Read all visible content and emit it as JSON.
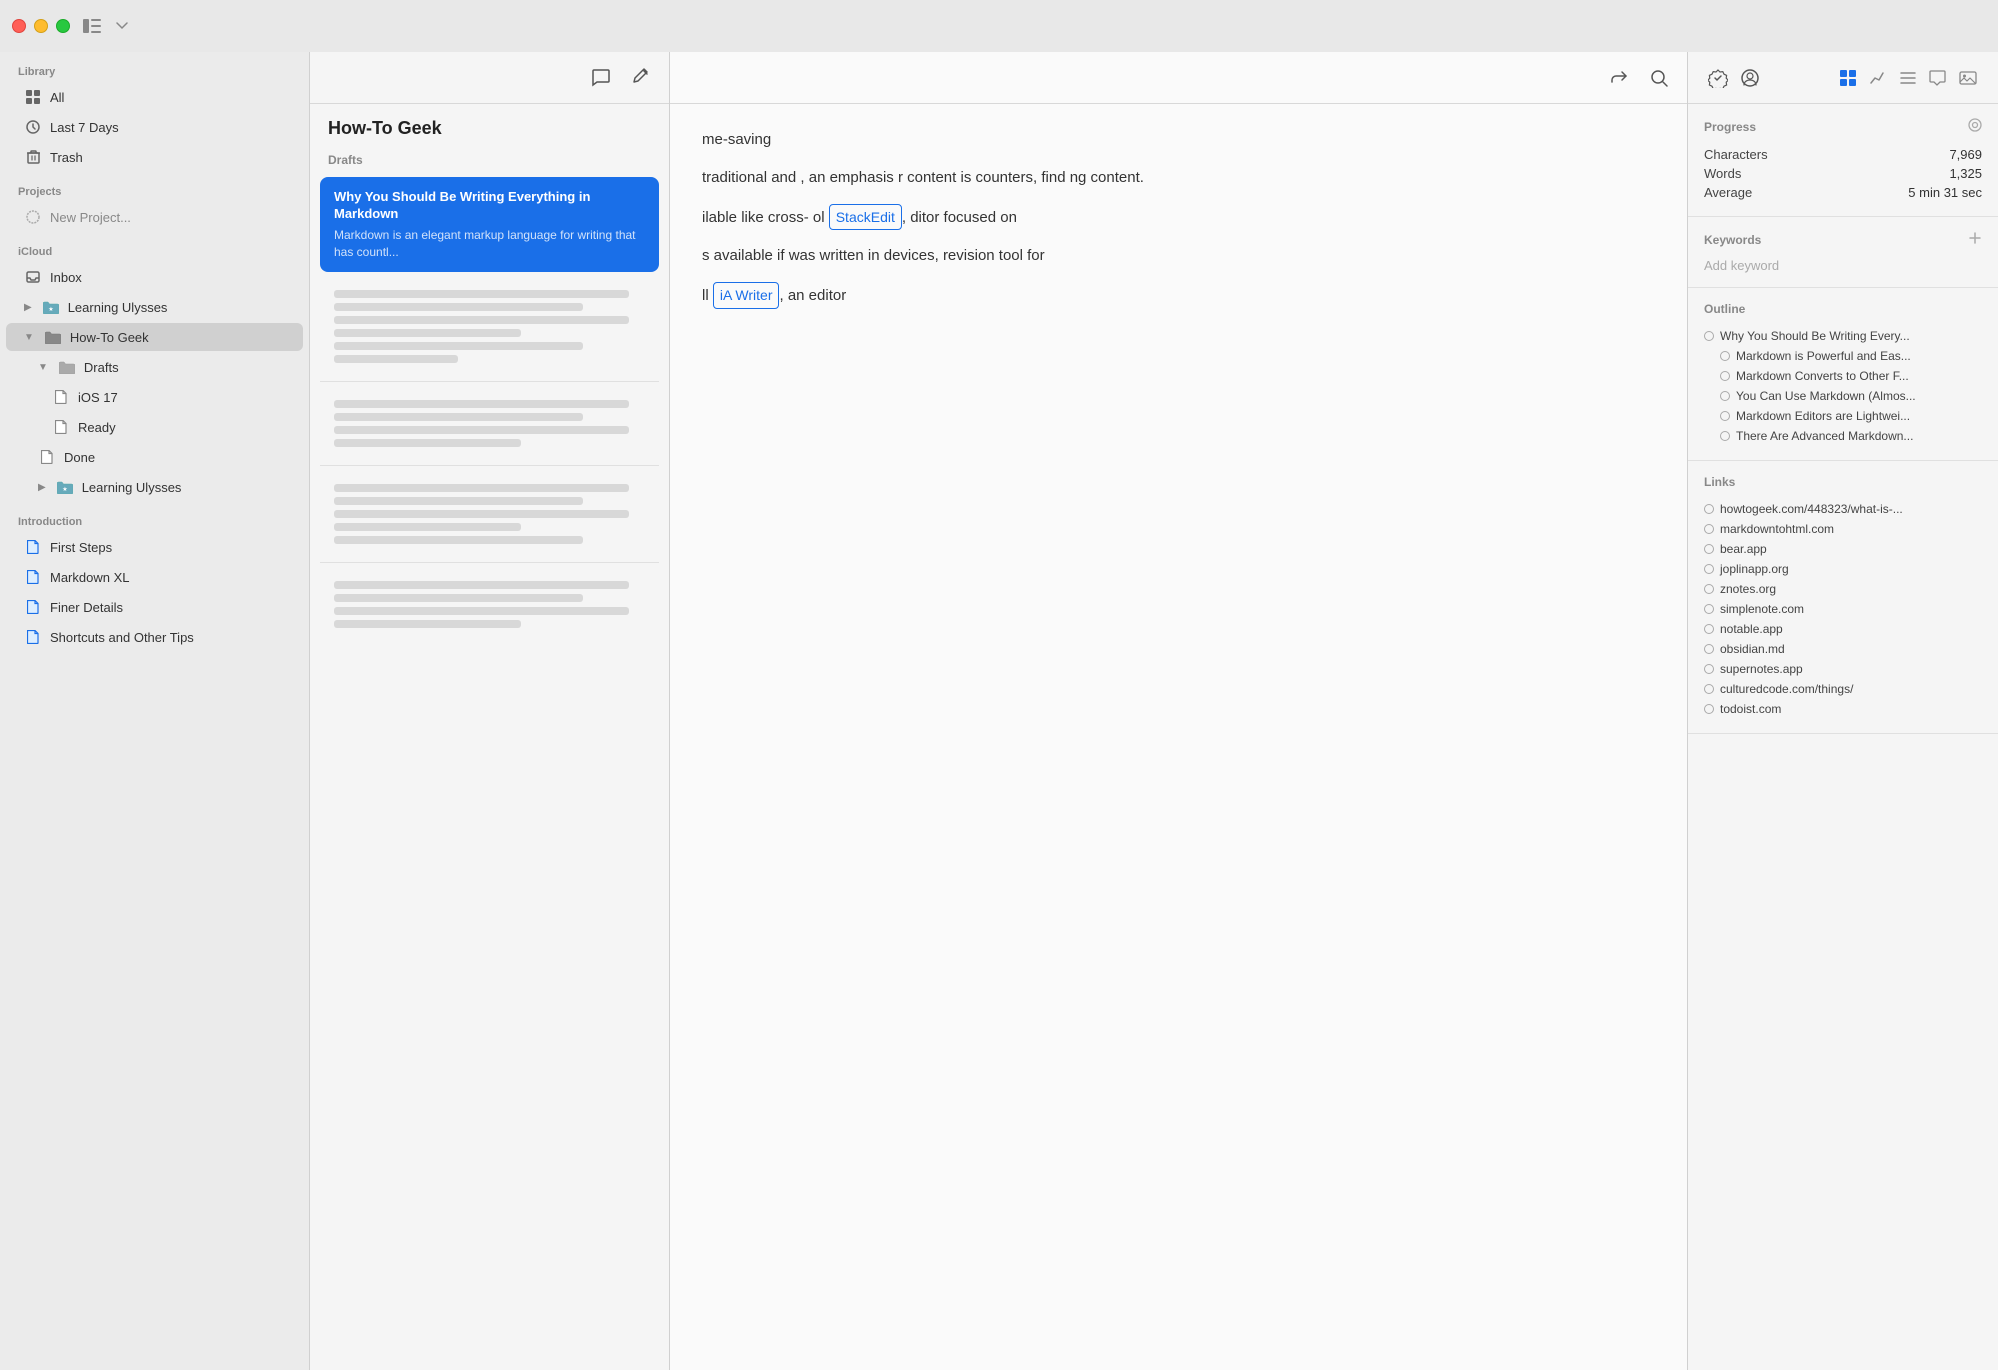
{
  "titlebar": {
    "traffic_lights": [
      "close",
      "minimize",
      "maximize"
    ],
    "sidebar_toggle_icon": "sidebar",
    "chevron_icon": "chevron-down"
  },
  "sidebar": {
    "library_header": "Library",
    "library_items": [
      {
        "id": "all",
        "icon": "grid",
        "label": "All"
      },
      {
        "id": "last7days",
        "icon": "clock",
        "label": "Last 7 Days"
      },
      {
        "id": "trash",
        "icon": "trash",
        "label": "Trash"
      }
    ],
    "projects_header": "Projects",
    "new_project_label": "New Project...",
    "icloud_header": "iCloud",
    "icloud_items": [
      {
        "id": "inbox",
        "icon": "inbox",
        "label": "Inbox"
      },
      {
        "id": "learning-ulysses-1",
        "icon": "folder-star",
        "label": "Learning Ulysses",
        "expanded": false
      },
      {
        "id": "how-to-geek",
        "icon": "folder-doc",
        "label": "How-To Geek",
        "expanded": true,
        "active": true
      }
    ],
    "how_to_geek_children": [
      {
        "id": "drafts",
        "icon": "folder-doc",
        "label": "Drafts",
        "expanded": true
      },
      {
        "id": "ios17",
        "icon": "doc",
        "label": "iOS 17",
        "indent": 3
      },
      {
        "id": "ready",
        "icon": "doc",
        "label": "Ready",
        "indent": 3
      },
      {
        "id": "done",
        "icon": "doc",
        "label": "Done",
        "indent": 2
      },
      {
        "id": "learning-ulysses-2",
        "icon": "folder-star",
        "label": "Learning Ulysses",
        "indent": 1
      }
    ],
    "introduction_header": "Introduction",
    "introduction_items": [
      {
        "id": "first-steps",
        "icon": "doc-blue",
        "label": "First Steps"
      },
      {
        "id": "markdown-xl",
        "icon": "doc-blue",
        "label": "Markdown XL"
      },
      {
        "id": "finer-details",
        "icon": "doc-blue",
        "label": "Finer Details"
      },
      {
        "id": "shortcuts",
        "icon": "doc-blue",
        "label": "Shortcuts and Other Tips"
      }
    ]
  },
  "doc_list": {
    "group_title": "How-To Geek",
    "toolbar_icons": [
      "comment",
      "compose"
    ],
    "drafts_label": "Drafts",
    "selected_doc": {
      "title": "Why You Should Be Writing Everything in Markdown",
      "preview": "Markdown is an elegant markup language for writing that has countl..."
    },
    "other_docs": [
      {
        "id": "doc2",
        "lines": [
          90,
          60,
          80,
          50,
          70,
          40
        ]
      },
      {
        "id": "doc3",
        "lines": [
          85,
          55,
          75,
          45
        ]
      },
      {
        "id": "doc4",
        "lines": [
          80,
          60,
          70,
          50,
          65
        ]
      }
    ]
  },
  "editor": {
    "toolbar_icons": [
      "share",
      "search"
    ],
    "content_paragraphs": [
      "me-saving",
      "traditional and , an emphasis r content is counters, find ng content.",
      "ilable like cross- ol StackEdit , ditor focused on",
      "s available if was written in devices, revision tool for",
      "ll iA Writer , an editor"
    ],
    "stackedit_link": "StackEdit",
    "ia_writer_link": "iA Writer"
  },
  "right_panel": {
    "toolbar_icons": [
      {
        "id": "grid",
        "label": "grid-view",
        "active": true
      },
      {
        "id": "chart",
        "label": "chart-view"
      },
      {
        "id": "list",
        "label": "list-view"
      },
      {
        "id": "comment",
        "label": "comment-view"
      },
      {
        "id": "image",
        "label": "image-view"
      }
    ],
    "toolbar_right_icons": [
      "checkmark-seal",
      "person-circle"
    ],
    "progress": {
      "header": "Progress",
      "settings_icon": "gear",
      "characters_label": "Characters",
      "characters_value": "7,969",
      "words_label": "Words",
      "words_value": "1,325",
      "average_label": "Average",
      "average_value": "5 min 31 sec"
    },
    "keywords": {
      "header": "Keywords",
      "add_label": "Add keyword",
      "add_icon": "plus"
    },
    "outline": {
      "header": "Outline",
      "items": [
        "Why You Should Be Writing Every...",
        "Markdown is Powerful and Eas...",
        "Markdown Converts to Other F...",
        "You Can Use Markdown (Almos...",
        "Markdown Editors are Lightwei...",
        "There Are Advanced Markdown..."
      ]
    },
    "links": {
      "header": "Links",
      "items": [
        "howtogeek.com/448323/what-is-...",
        "markdowntohtml.com",
        "bear.app",
        "joplinapp.org",
        "znotes.org",
        "simplenote.com",
        "notable.app",
        "obsidian.md",
        "supernotes.app",
        "culturedcode.com/things/",
        "todoist.com"
      ]
    }
  }
}
